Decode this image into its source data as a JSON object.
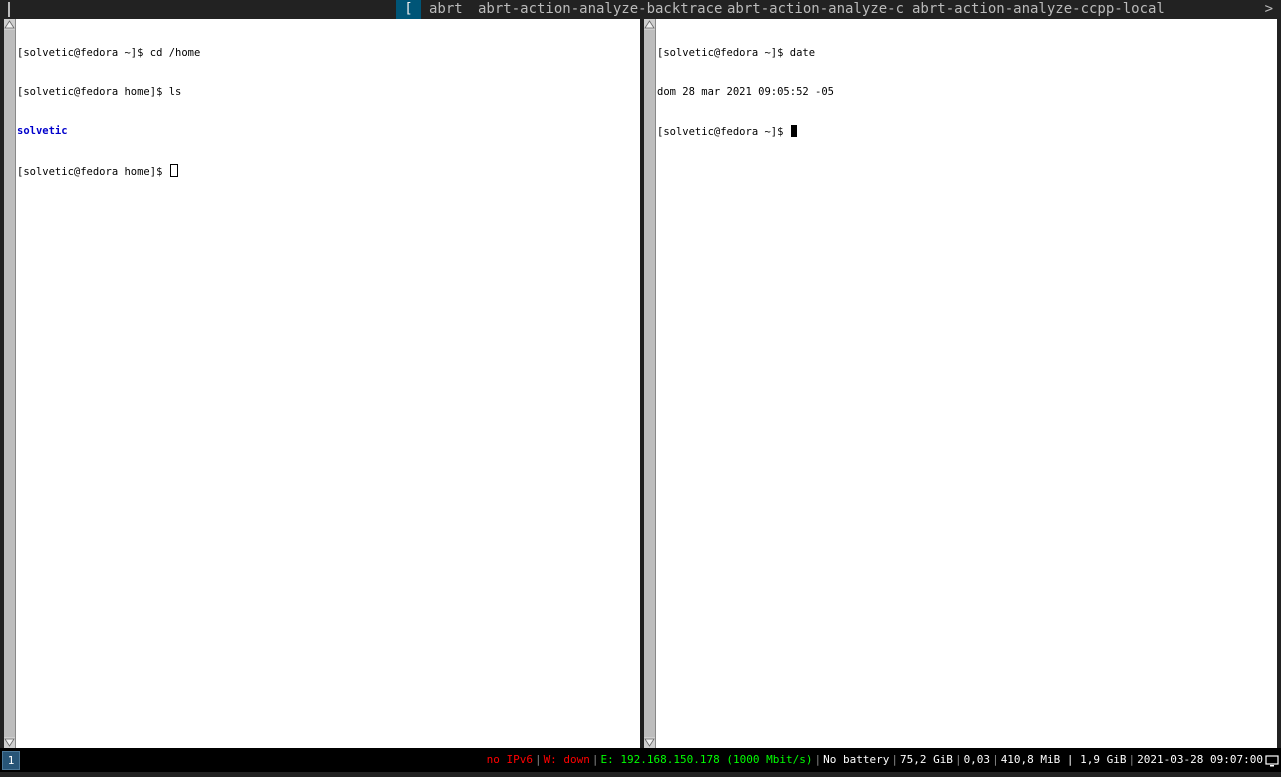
{
  "dmenu": {
    "prompt": "",
    "selected": "[",
    "items": [
      "abrt",
      "abrt-action-analyze-backtrace",
      "abrt-action-analyze-c",
      "abrt-action-analyze-ccpp-local"
    ],
    "more_indicator": ">"
  },
  "terminal_left": {
    "lines": [
      "[solvetic@fedora ~]$ cd /home",
      "[solvetic@fedora home]$ ls",
      "solvetic",
      "[solvetic@fedora home]$ "
    ]
  },
  "terminal_right": {
    "lines": [
      "[solvetic@fedora ~]$ date",
      "dom 28 mar 2021 09:05:52 -05",
      "[solvetic@fedora ~]$ "
    ]
  },
  "statusbar": {
    "workspace": "1",
    "ipv6": "no IPv6",
    "wireless": "W: down",
    "ethernet": "E: 192.168.150.178 (1000 Mbit/s)",
    "battery": "No battery",
    "disk": "75,2 GiB",
    "load": "0,03",
    "memory": "410,8 MiB | 1,9 GiB",
    "datetime": "2021-03-28 09:07:00"
  },
  "colors": {
    "dmenu_bg": "#222222",
    "dmenu_sel": "#005577",
    "status_red": "#ff0000",
    "status_green": "#00ff00",
    "workspace_bg": "#285577",
    "dir_blue": "#0000cc"
  },
  "icons": {
    "tray": "monitor-icon"
  }
}
